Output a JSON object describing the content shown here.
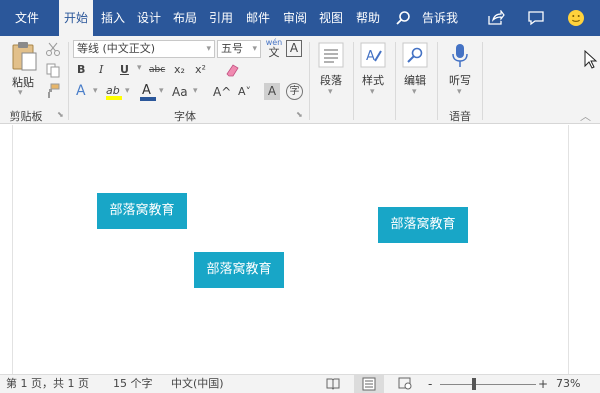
{
  "tabs": [
    "文件",
    "开始",
    "插入",
    "设计",
    "布局",
    "引用",
    "邮件",
    "审阅",
    "视图",
    "帮助"
  ],
  "tell_me": "告诉我",
  "clipboard": {
    "paste": "粘贴",
    "group": "剪贴板"
  },
  "font": {
    "name": "等线 (中文正文)",
    "size": "五号",
    "wen_top": "wén",
    "wen_bottom": "文",
    "char_border": "A",
    "bold": "B",
    "italic": "I",
    "underline": "U",
    "strike": "abc",
    "sub": "x₂",
    "sup": "x²",
    "text_effect": "A",
    "highlight": "ab",
    "font_color": "A",
    "case": "Aa",
    "grow": "A^",
    "shrink": "A˅",
    "shade": "A",
    "enclose": "字",
    "group": "字体"
  },
  "paragraph": {
    "label": "段落"
  },
  "styles": {
    "label": "样式"
  },
  "editing": {
    "label": "编辑"
  },
  "voice": {
    "dictate": "听写",
    "group": "语音"
  },
  "doc_boxes": [
    "部落窝教育",
    "部落窝教育",
    "部落窝教育"
  ],
  "status": {
    "page": "第 1 页，共 1 页",
    "words": "15 个字",
    "lang": "中文(中国)",
    "zoom": "73%",
    "minus": "-",
    "plus": "+"
  },
  "colors": {
    "accent": "#2b579a",
    "box": "#18a6c7",
    "highlight": "#ffff00",
    "fontcolor": "#c00000"
  },
  "icons": [
    "share-icon",
    "comment-icon",
    "smiley-icon",
    "search-icon",
    "cut-icon",
    "copy-icon",
    "format-painter-icon",
    "eraser-icon",
    "paragraph-icon",
    "styles-icon",
    "find-icon",
    "microphone-icon",
    "collapse-ribbon-icon",
    "read-mode-icon",
    "print-layout-icon",
    "web-layout-icon",
    "cursor-icon"
  ]
}
